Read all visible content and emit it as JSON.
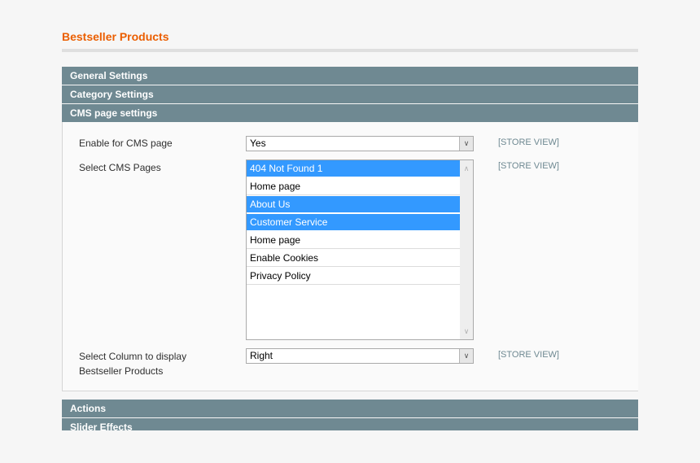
{
  "page": {
    "title": "Bestseller Products"
  },
  "sections": {
    "general": "General Settings",
    "category": "Category Settings",
    "cms": "CMS page settings",
    "actions": "Actions",
    "slider": "Slider Effects"
  },
  "cms_settings": {
    "enable": {
      "label": "Enable for CMS page",
      "value": "Yes",
      "scope": "[STORE VIEW]"
    },
    "pages": {
      "label": "Select CMS Pages",
      "scope": "[STORE VIEW]",
      "options": [
        {
          "label": "404 Not Found 1",
          "selected": true
        },
        {
          "label": "Home page",
          "selected": false
        },
        {
          "label": "About Us",
          "selected": true
        },
        {
          "label": "Customer Service",
          "selected": true
        },
        {
          "label": "Home page",
          "selected": false
        },
        {
          "label": "Enable Cookies",
          "selected": false
        },
        {
          "label": "Privacy Policy",
          "selected": false
        }
      ]
    },
    "column": {
      "label_line1": "Select Column to display",
      "label_line2": "Bestseller Products",
      "value": "Right",
      "scope": "[STORE VIEW]"
    }
  },
  "icons": {
    "dropdown": "chevron-down-icon",
    "scroll_up": "chevron-up-icon",
    "scroll_down": "chevron-down-icon"
  },
  "colors": {
    "title": "#eb5e00",
    "section_header": "#6f8992",
    "selected_option": "#3399ff",
    "scope_text": "#6f8992"
  }
}
